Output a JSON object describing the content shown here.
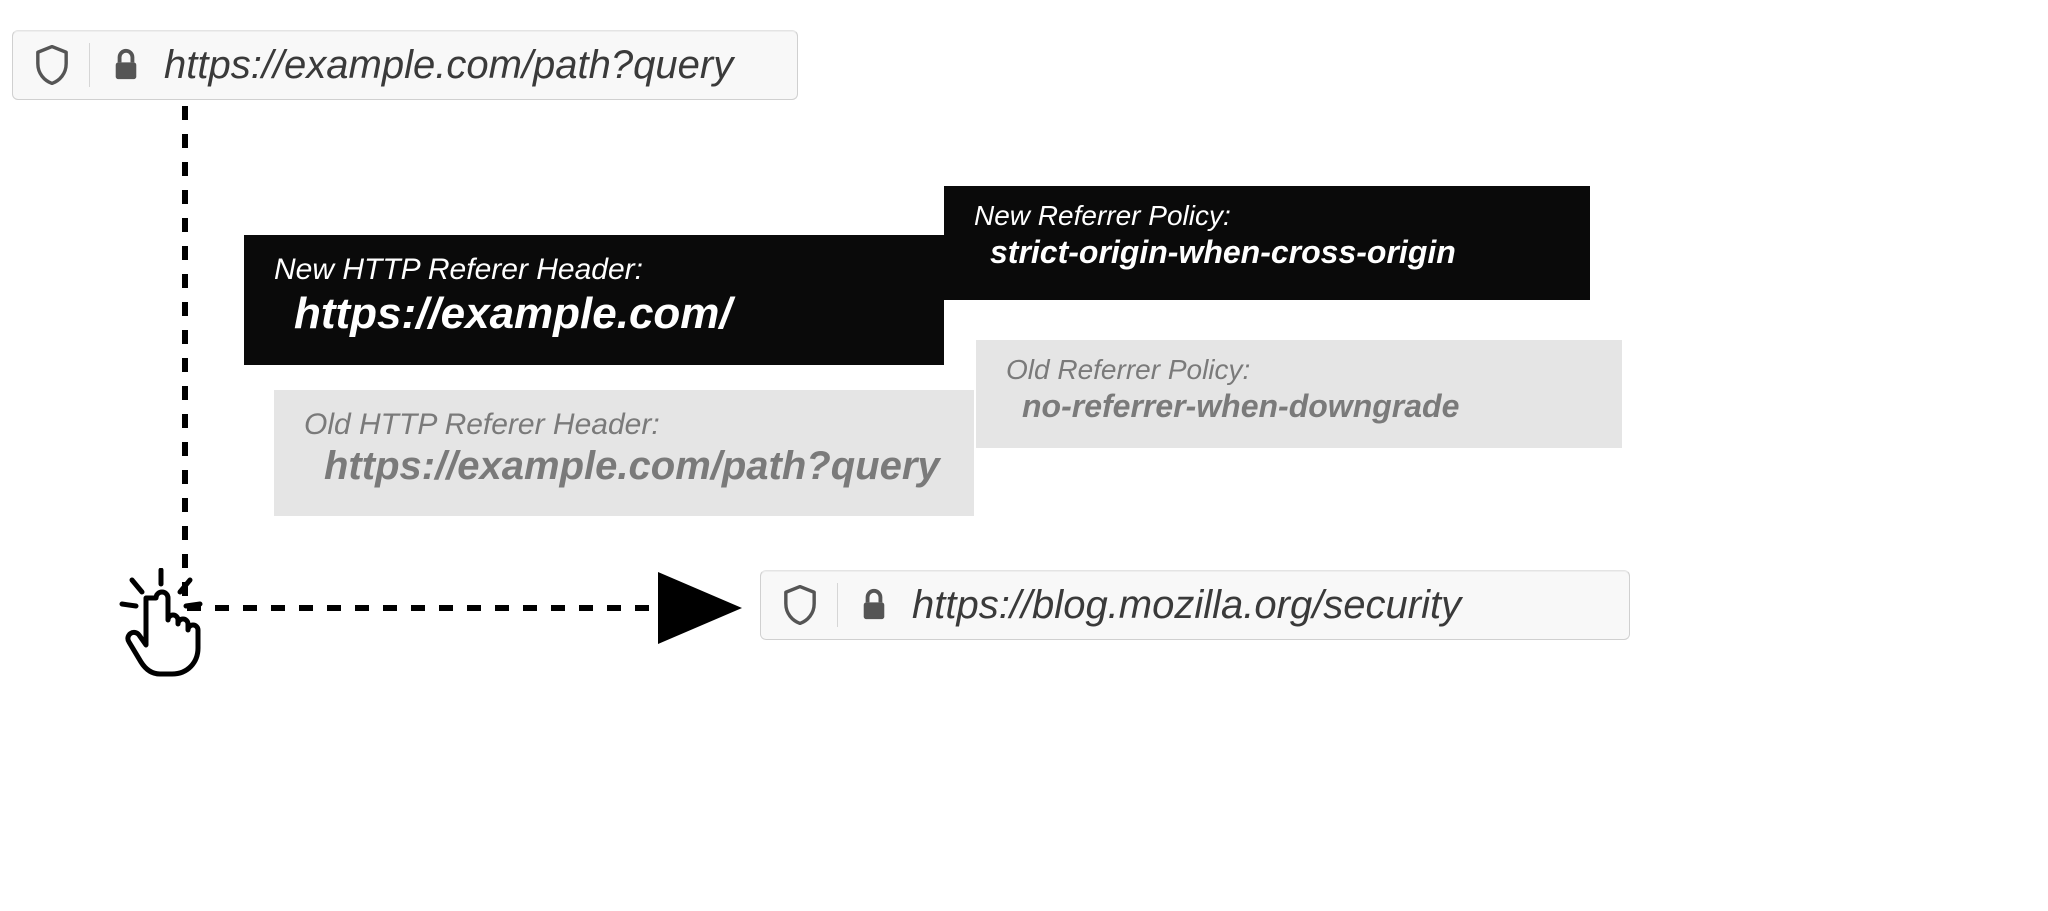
{
  "top_bar": {
    "url": "https://example.com/path?query"
  },
  "bottom_bar": {
    "url": "https://blog.mozilla.org/security"
  },
  "new_referer": {
    "label": "New HTTP Referer Header:",
    "value": "https://example.com/"
  },
  "old_referer": {
    "label": "Old HTTP Referer Header:",
    "value": "https://example.com/path?query"
  },
  "new_policy": {
    "label": "New Referrer Policy:",
    "value": "strict-origin-when-cross-origin"
  },
  "old_policy": {
    "label": "Old Referrer Policy:",
    "value": "no-referrer-when-downgrade"
  }
}
